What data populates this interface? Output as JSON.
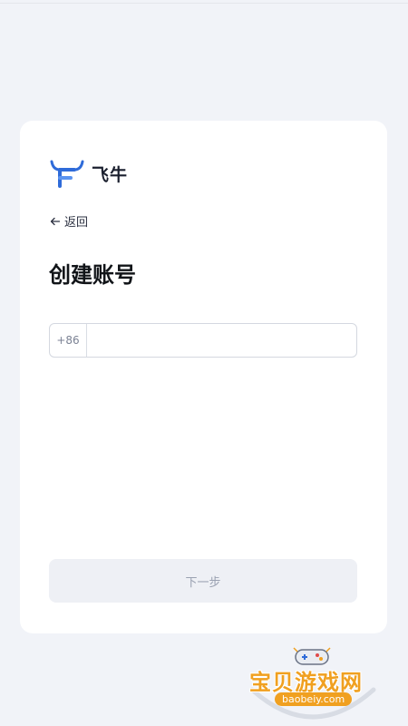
{
  "app": {
    "logo_icon": "bull-horns-logo-icon",
    "name": "飞牛"
  },
  "nav": {
    "back_icon": "arrow-left-icon",
    "back_label": "返回"
  },
  "page": {
    "title": "创建账号"
  },
  "phone_field": {
    "country_code": "+86",
    "value": "",
    "placeholder": ""
  },
  "actions": {
    "next_label": "下一步"
  },
  "watermark": {
    "text": "宝贝游戏网",
    "url": "baobeiy.com"
  },
  "colors": {
    "page_background": "#f1f3f8",
    "card_background": "#ffffff",
    "logo_blue": "#2f6bd9",
    "button_disabled_bg": "#eef0f5",
    "button_disabled_text": "#9aa1b1",
    "watermark_orange": "#f0a020"
  }
}
